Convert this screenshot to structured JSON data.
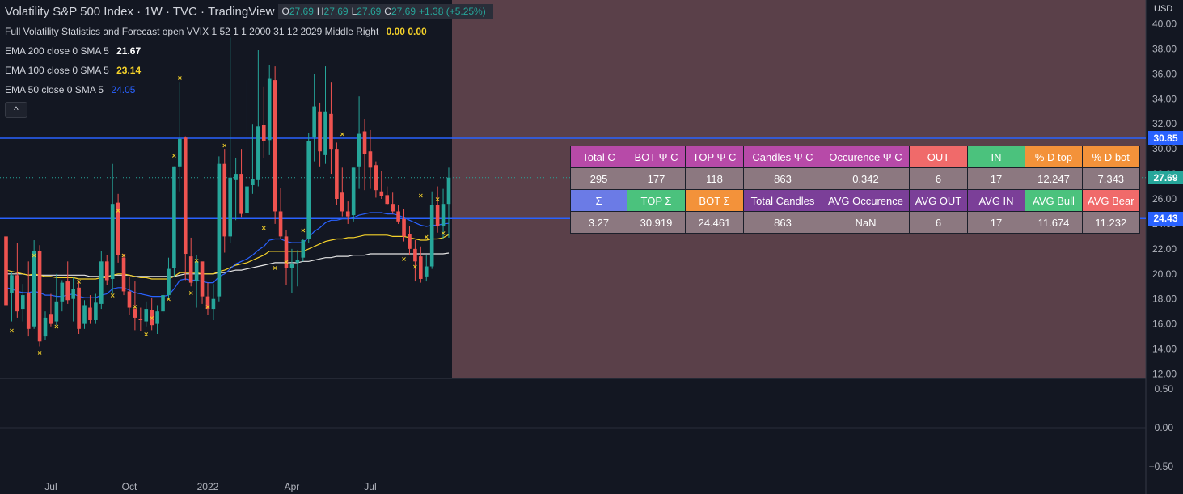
{
  "legend": {
    "symbol": "Volatility S&P 500 Index · 1W · TVC · TradingView",
    "ohlc": [
      {
        "k": "O",
        "v": "27.69"
      },
      {
        "k": "H",
        "v": "27.69"
      },
      {
        "k": "L",
        "v": "27.69"
      },
      {
        "k": "C",
        "v": "27.69"
      },
      {
        "k": "",
        "v": "+1.38 (+5.25%)"
      }
    ],
    "indicator": "Full Volatility Statistics and Forecast open VVIX 1 52 1 1 2000 31 12 2029 Middle Right",
    "indicator_values": "0.00  0.00",
    "ema200": "EMA 200 close 0 SMA 5",
    "ema200_value": "21.67",
    "ema100": "EMA 100 close 0 SMA 5",
    "ema100_value": "23.14",
    "ema50": "EMA 50 close 0 SMA 5",
    "ema50_value": "24.05",
    "collapse_icon": "^"
  },
  "currency": "USD",
  "price_badges": [
    {
      "label": "30.85",
      "value": 30.85,
      "color": "#2962ff"
    },
    {
      "label": "27.69",
      "value": 27.69,
      "color": "#26a69a"
    },
    {
      "label": "24.43",
      "value": 24.43,
      "color": "#2962ff"
    }
  ],
  "table": {
    "row1": [
      {
        "t": "Total C",
        "bg": "#b74aa8",
        "c": "c-total"
      },
      {
        "t": "BOT Ψ C",
        "bg": "#b74aa8",
        "c": "c-bot"
      },
      {
        "t": "TOP Ψ C",
        "bg": "#b74aa8",
        "c": "c-top"
      },
      {
        "t": "Candles Ψ C",
        "bg": "#b74aa8",
        "c": "c-candles"
      },
      {
        "t": "Occurence Ψ C",
        "bg": "#b74aa8",
        "c": "c-occ"
      },
      {
        "t": "OUT",
        "bg": "#f06a6a",
        "c": "c-out"
      },
      {
        "t": "IN",
        "bg": "#4bc27d",
        "c": "c-in"
      },
      {
        "t": "% D top",
        "bg": "#f3923a",
        "c": "c-dtop"
      },
      {
        "t": "% D bot",
        "bg": "#f3923a",
        "c": "c-dbot"
      }
    ],
    "row2": [
      "295",
      "177",
      "118",
      "863",
      "0.342",
      "6",
      "17",
      "12.247",
      "7.343"
    ],
    "row3": [
      {
        "t": "Σ",
        "bg": "#6b7be6"
      },
      {
        "t": "TOP Σ",
        "bg": "#4bc27d"
      },
      {
        "t": "BOT Σ",
        "bg": "#f3923a"
      },
      {
        "t": "Total Candles",
        "bg": "#7b3f98"
      },
      {
        "t": "AVG Occurence",
        "bg": "#7b3f98"
      },
      {
        "t": "AVG OUT",
        "bg": "#7b3f98"
      },
      {
        "t": "AVG IN",
        "bg": "#7b3f98"
      },
      {
        "t": "AVG Bull",
        "bg": "#4bc27d"
      },
      {
        "t": "AVG Bear",
        "bg": "#f06a6a"
      }
    ],
    "row4": [
      "3.27",
      "30.919",
      "24.461",
      "863",
      "NaN",
      "6",
      "17",
      "11.674",
      "11.232"
    ]
  },
  "chart_data": {
    "type": "candlestick",
    "title": "Volatility S&P 500 Index · 1W · TVC · TradingView",
    "ylim": [
      12,
      40.5
    ],
    "yticks": [
      "40.00",
      "38.00",
      "36.00",
      "34.00",
      "32.00",
      "30.00",
      "28.00",
      "26.00",
      "24.00",
      "22.00",
      "20.00",
      "18.00",
      "16.00",
      "14.00",
      "12.00"
    ],
    "ytick_values": [
      40,
      38,
      36,
      34,
      32,
      30,
      28,
      26,
      24,
      22,
      20,
      18,
      16,
      14,
      12
    ],
    "lower_pane_ticks": [
      "0.50",
      "0.00",
      "−0.50"
    ],
    "lower_pane_tick_values": [
      0.5,
      0,
      -0.5
    ],
    "xticks": [
      "Jul",
      "Oct",
      "2022",
      "Apr",
      "Jul"
    ],
    "xtick_index": [
      8,
      22,
      36,
      51,
      65
    ],
    "horizontal_levels": [
      30.85,
      24.43
    ],
    "candles": [
      {
        "o": 23.0,
        "h": 25.2,
        "l": 17.2,
        "c": 17.5
      },
      {
        "o": 18.5,
        "h": 20.1,
        "l": 16.2,
        "c": 19.9
      },
      {
        "o": 19.9,
        "h": 22.5,
        "l": 16.5,
        "c": 17.0
      },
      {
        "o": 17.2,
        "h": 19.2,
        "l": 16.2,
        "c": 18.3
      },
      {
        "o": 18.5,
        "h": 21.0,
        "l": 15.0,
        "c": 15.6
      },
      {
        "o": 15.8,
        "h": 22.7,
        "l": 15.6,
        "c": 21.8
      },
      {
        "o": 21.8,
        "h": 22.3,
        "l": 14.2,
        "c": 14.6
      },
      {
        "o": 15.0,
        "h": 17.0,
        "l": 14.7,
        "c": 16.5
      },
      {
        "o": 16.8,
        "h": 18.4,
        "l": 15.8,
        "c": 16.0
      },
      {
        "o": 16.2,
        "h": 20.0,
        "l": 15.9,
        "c": 17.8
      },
      {
        "o": 17.8,
        "h": 19.5,
        "l": 17.0,
        "c": 19.3
      },
      {
        "o": 19.4,
        "h": 21.0,
        "l": 17.6,
        "c": 17.9
      },
      {
        "o": 18.0,
        "h": 19.7,
        "l": 16.2,
        "c": 18.8
      },
      {
        "o": 18.9,
        "h": 19.5,
        "l": 15.2,
        "c": 15.6
      },
      {
        "o": 16.0,
        "h": 17.9,
        "l": 15.6,
        "c": 17.5
      },
      {
        "o": 17.3,
        "h": 18.3,
        "l": 16.0,
        "c": 16.3
      },
      {
        "o": 16.3,
        "h": 18.4,
        "l": 16.0,
        "c": 17.7
      },
      {
        "o": 17.6,
        "h": 21.8,
        "l": 17.2,
        "c": 21.0
      },
      {
        "o": 21.0,
        "h": 21.5,
        "l": 19.1,
        "c": 19.5
      },
      {
        "o": 19.6,
        "h": 28.8,
        "l": 18.4,
        "c": 25.6
      },
      {
        "o": 25.7,
        "h": 26.4,
        "l": 20.9,
        "c": 21.5
      },
      {
        "o": 21.3,
        "h": 21.6,
        "l": 18.3,
        "c": 18.6
      },
      {
        "o": 18.6,
        "h": 19.8,
        "l": 16.7,
        "c": 17.3
      },
      {
        "o": 17.2,
        "h": 19.4,
        "l": 15.5,
        "c": 16.5
      },
      {
        "o": 16.4,
        "h": 17.3,
        "l": 15.4,
        "c": 16.3
      },
      {
        "o": 16.2,
        "h": 17.8,
        "l": 15.8,
        "c": 17.2
      },
      {
        "o": 17.1,
        "h": 18.1,
        "l": 15.5,
        "c": 15.9
      },
      {
        "o": 16.0,
        "h": 17.5,
        "l": 15.2,
        "c": 17.0
      },
      {
        "o": 17.0,
        "h": 18.5,
        "l": 16.8,
        "c": 18.3
      },
      {
        "o": 18.3,
        "h": 21.3,
        "l": 18.0,
        "c": 20.4
      },
      {
        "o": 20.5,
        "h": 28.6,
        "l": 19.8,
        "c": 28.6
      },
      {
        "o": 28.6,
        "h": 35.3,
        "l": 26.6,
        "c": 30.8
      },
      {
        "o": 30.9,
        "h": 31.0,
        "l": 19.5,
        "c": 21.6
      },
      {
        "o": 21.4,
        "h": 22.9,
        "l": 19.0,
        "c": 19.3
      },
      {
        "o": 19.4,
        "h": 21.5,
        "l": 17.3,
        "c": 21.0
      },
      {
        "o": 21.0,
        "h": 20.0,
        "l": 17.6,
        "c": 18.2
      },
      {
        "o": 18.2,
        "h": 19.3,
        "l": 16.7,
        "c": 17.2
      },
      {
        "o": 17.2,
        "h": 19.2,
        "l": 16.3,
        "c": 18.0
      },
      {
        "o": 18.2,
        "h": 29.4,
        "l": 17.8,
        "c": 28.8
      },
      {
        "o": 28.8,
        "h": 30.0,
        "l": 21.7,
        "c": 23.0
      },
      {
        "o": 23.0,
        "h": 38.9,
        "l": 22.5,
        "c": 27.7
      },
      {
        "o": 27.5,
        "h": 29.3,
        "l": 24.3,
        "c": 28.0
      },
      {
        "o": 28.0,
        "h": 30.0,
        "l": 24.5,
        "c": 24.8
      },
      {
        "o": 24.9,
        "h": 35.5,
        "l": 24.3,
        "c": 27.0
      },
      {
        "o": 27.1,
        "h": 32.0,
        "l": 26.4,
        "c": 27.6
      },
      {
        "o": 27.5,
        "h": 37.9,
        "l": 27.0,
        "c": 31.8
      },
      {
        "o": 31.9,
        "h": 35.0,
        "l": 29.3,
        "c": 30.6
      },
      {
        "o": 30.7,
        "h": 36.7,
        "l": 29.5,
        "c": 35.6
      },
      {
        "o": 35.5,
        "h": 36.6,
        "l": 24.0,
        "c": 25.0
      },
      {
        "o": 25.0,
        "h": 26.9,
        "l": 22.8,
        "c": 23.0
      },
      {
        "o": 23.0,
        "h": 23.5,
        "l": 19.1,
        "c": 20.5
      },
      {
        "o": 20.5,
        "h": 22.0,
        "l": 18.5,
        "c": 20.8
      },
      {
        "o": 20.9,
        "h": 21.9,
        "l": 19.0,
        "c": 21.1
      },
      {
        "o": 21.3,
        "h": 22.8,
        "l": 21.0,
        "c": 22.7
      },
      {
        "o": 22.8,
        "h": 31.3,
        "l": 22.5,
        "c": 30.6
      },
      {
        "o": 30.9,
        "h": 36.0,
        "l": 29.0,
        "c": 33.4
      },
      {
        "o": 33.0,
        "h": 33.7,
        "l": 28.6,
        "c": 29.8
      },
      {
        "o": 29.5,
        "h": 36.6,
        "l": 28.8,
        "c": 33.0
      },
      {
        "o": 32.8,
        "h": 35.3,
        "l": 28.0,
        "c": 30.0
      },
      {
        "o": 30.0,
        "h": 30.5,
        "l": 25.5,
        "c": 26.0
      },
      {
        "o": 26.5,
        "h": 28.5,
        "l": 24.6,
        "c": 25.0
      },
      {
        "o": 25.0,
        "h": 25.8,
        "l": 24.0,
        "c": 24.6
      },
      {
        "o": 24.7,
        "h": 28.5,
        "l": 24.2,
        "c": 28.5
      },
      {
        "o": 28.6,
        "h": 34.2,
        "l": 26.8,
        "c": 31.2
      },
      {
        "o": 31.4,
        "h": 32.4,
        "l": 26.7,
        "c": 29.6
      },
      {
        "o": 29.8,
        "h": 31.5,
        "l": 26.8,
        "c": 28.5
      },
      {
        "o": 28.7,
        "h": 29.0,
        "l": 26.1,
        "c": 26.7
      },
      {
        "o": 26.6,
        "h": 28.2,
        "l": 26.0,
        "c": 26.2
      },
      {
        "o": 26.3,
        "h": 27.0,
        "l": 25.5,
        "c": 25.6
      },
      {
        "o": 25.6,
        "h": 26.5,
        "l": 24.8,
        "c": 25.0
      },
      {
        "o": 25.0,
        "h": 25.5,
        "l": 24.0,
        "c": 24.2
      },
      {
        "o": 24.4,
        "h": 25.2,
        "l": 22.6,
        "c": 23.0
      },
      {
        "o": 23.2,
        "h": 23.8,
        "l": 21.5,
        "c": 22.0
      },
      {
        "o": 22.0,
        "h": 22.7,
        "l": 19.4,
        "c": 21.0
      },
      {
        "o": 21.4,
        "h": 22.2,
        "l": 19.3,
        "c": 19.6
      },
      {
        "o": 19.8,
        "h": 21.5,
        "l": 19.4,
        "c": 20.6
      },
      {
        "o": 20.6,
        "h": 26.6,
        "l": 20.4,
        "c": 25.5
      },
      {
        "o": 25.5,
        "h": 27.0,
        "l": 23.3,
        "c": 23.8
      },
      {
        "o": 23.8,
        "h": 26.8,
        "l": 22.8,
        "c": 25.6
      },
      {
        "o": 25.6,
        "h": 28.5,
        "l": 22.9,
        "c": 27.7
      }
    ],
    "ema50": [
      18.9,
      18.8,
      18.6,
      18.5,
      18.5,
      18.6,
      18.5,
      18.3,
      18.3,
      18.2,
      18.2,
      18.3,
      18.4,
      18.2,
      18.1,
      18.1,
      18.1,
      18.3,
      18.4,
      18.8,
      18.9,
      18.9,
      18.7,
      18.5,
      18.4,
      18.3,
      18.2,
      18.2,
      18.2,
      18.3,
      18.8,
      19.5,
      19.6,
      19.5,
      19.5,
      19.4,
      19.3,
      19.3,
      19.8,
      20.0,
      20.4,
      20.8,
      21.0,
      21.2,
      21.5,
      21.9,
      22.2,
      22.7,
      22.8,
      22.8,
      22.6,
      22.5,
      22.5,
      22.5,
      22.9,
      23.4,
      23.7,
      24.1,
      24.3,
      24.3,
      24.4,
      24.4,
      24.5,
      24.7,
      24.8,
      24.9,
      24.9,
      24.9,
      24.8,
      24.8,
      24.7,
      24.5,
      24.3,
      24.1,
      23.9,
      23.8,
      23.9,
      23.9,
      24.0,
      24.05
    ],
    "ema100": [
      20.3,
      20.2,
      20.1,
      20.0,
      19.9,
      20.0,
      19.9,
      19.8,
      19.8,
      19.7,
      19.7,
      19.7,
      19.7,
      19.6,
      19.6,
      19.6,
      19.6,
      19.7,
      19.7,
      19.9,
      20.0,
      20.0,
      19.9,
      19.8,
      19.7,
      19.7,
      19.6,
      19.6,
      19.6,
      19.6,
      19.8,
      20.1,
      20.1,
      20.1,
      20.1,
      20.0,
      20.0,
      20.0,
      20.2,
      20.3,
      20.5,
      20.7,
      20.8,
      20.9,
      21.1,
      21.3,
      21.5,
      21.8,
      21.8,
      21.8,
      21.8,
      21.8,
      21.8,
      21.8,
      22.0,
      22.2,
      22.4,
      22.6,
      22.7,
      22.8,
      22.8,
      22.9,
      22.9,
      23.0,
      23.1,
      23.1,
      23.1,
      23.1,
      23.1,
      23.0,
      23.0,
      23.0,
      22.9,
      22.8,
      22.7,
      22.7,
      22.8,
      22.8,
      22.9,
      23.14
    ],
    "ema200": [
      20.0,
      20.0,
      20.0,
      20.0,
      19.9,
      19.9,
      19.9,
      19.9,
      19.9,
      19.9,
      19.9,
      19.9,
      19.9,
      19.9,
      19.9,
      19.8,
      19.8,
      19.8,
      19.8,
      19.9,
      19.9,
      19.9,
      19.9,
      19.8,
      19.8,
      19.8,
      19.8,
      19.8,
      19.8,
      19.8,
      19.8,
      19.9,
      20.0,
      20.0,
      20.0,
      20.0,
      20.0,
      20.0,
      20.1,
      20.1,
      20.2,
      20.3,
      20.3,
      20.4,
      20.5,
      20.6,
      20.7,
      20.8,
      20.9,
      20.9,
      20.9,
      20.9,
      20.9,
      21.0,
      21.0,
      21.1,
      21.2,
      21.3,
      21.3,
      21.4,
      21.4,
      21.4,
      21.5,
      21.5,
      21.5,
      21.6,
      21.6,
      21.6,
      21.6,
      21.6,
      21.6,
      21.6,
      21.6,
      21.6,
      21.6,
      21.6,
      21.6,
      21.6,
      21.6,
      21.67
    ],
    "markers": [
      {
        "i": 1,
        "y": 15.5
      },
      {
        "i": 5,
        "y": 21.5
      },
      {
        "i": 6,
        "y": 13.7
      },
      {
        "i": 9,
        "y": 15.8
      },
      {
        "i": 13,
        "y": 19.4
      },
      {
        "i": 19,
        "y": 18.3
      },
      {
        "i": 20,
        "y": 25.1
      },
      {
        "i": 21,
        "y": 21.5
      },
      {
        "i": 23,
        "y": 17.4
      },
      {
        "i": 25,
        "y": 15.2
      },
      {
        "i": 26,
        "y": 16.5
      },
      {
        "i": 29,
        "y": 18.0
      },
      {
        "i": 30,
        "y": 29.5
      },
      {
        "i": 31,
        "y": 35.7
      },
      {
        "i": 33,
        "y": 18.5
      },
      {
        "i": 34,
        "y": 21.1
      },
      {
        "i": 36,
        "y": 17.4
      },
      {
        "i": 39,
        "y": 30.3
      },
      {
        "i": 46,
        "y": 23.7
      },
      {
        "i": 48,
        "y": 20.5
      },
      {
        "i": 50,
        "y": 21.0
      },
      {
        "i": 53,
        "y": 23.5
      },
      {
        "i": 60,
        "y": 31.2
      },
      {
        "i": 71,
        "y": 21.2
      },
      {
        "i": 73,
        "y": 20.6
      },
      {
        "i": 74,
        "y": 26.3
      },
      {
        "i": 75,
        "y": 23.0
      },
      {
        "i": 77,
        "y": 26.0
      },
      {
        "i": 78,
        "y": 23.3
      }
    ]
  }
}
